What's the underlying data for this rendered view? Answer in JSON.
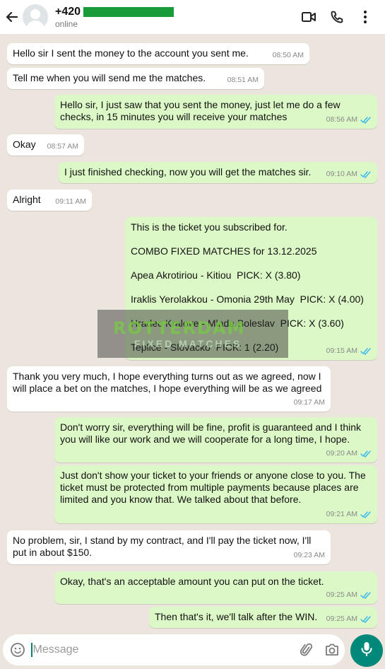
{
  "header": {
    "phone": "+420",
    "status": "online"
  },
  "messages": [
    {
      "side": "in",
      "text": "Hello sir I sent the money to the account you sent me.",
      "time": "08:50 AM"
    },
    {
      "side": "in",
      "text": "Tell me when you will send me the matches.",
      "time": "08:51 AM"
    },
    {
      "side": "out",
      "text": "Hello sir, I just saw that you sent the money, just let me do a few checks, in 15 minutes you will receive your matches",
      "time": "08:56 AM"
    },
    {
      "side": "in",
      "text": "Okay",
      "time": "08:57 AM"
    },
    {
      "side": "out",
      "text": "I just finished checking, now you will get the matches sir.",
      "time": "09:10 AM"
    },
    {
      "side": "in",
      "text": "Alright",
      "time": "09:11 AM"
    },
    {
      "side": "out",
      "text": "This is the ticket you subscribed for.\n\nCOMBO FIXED MATCHES for 13.12.2025\n\nApea Akrotiriou - Kitiou  PICK: X (3.80)\n\nIraklis Yerolakkou - Omonia 29th May  PICK: X (4.00)\n\nHradec Kralove - Mlada Boleslav  PICK: X (3.60)\n\nTeplice - Slovacko  PICK: 1 (2.20)",
      "time": "09:15 AM"
    },
    {
      "side": "in",
      "text": "Thank you very much, I hope everything turns out as we agreed, now I will place a bet on the matches, I hope everything will be as we agreed",
      "time": "09:17 AM"
    },
    {
      "side": "out",
      "text": "Don't worry sir, everything will be fine, profit is guaranteed and I think you will like our work and we will cooperate for a long time, I hope.",
      "time": "09:20 AM"
    },
    {
      "side": "out",
      "text": "Just don't show your ticket to your friends or anyone close to you. The ticket must be protected from multiple payments because places are limited and you know that. We talked about that before.",
      "time": "09:21 AM"
    },
    {
      "side": "in",
      "text": "No problem, sir, I stand by my contract, and I'll pay the ticket now, I'll put in about $150.",
      "time": "09:23 AM"
    },
    {
      "side": "out",
      "text": "Okay, that's an acceptable amount you can put on the ticket.",
      "time": "09:25 AM"
    },
    {
      "side": "out",
      "text": "Then that's it, we'll talk after the WIN.",
      "time": "09:25 AM"
    }
  ],
  "watermark": {
    "line1": "ROTTERDAM",
    "line2": "FIXED MATCHES"
  },
  "input": {
    "placeholder": "Message"
  },
  "colors": {
    "incoming": "#FFFFFF",
    "outgoing": "#DCF8C6",
    "background": "#ECE5DD",
    "read_tick": "#34B7F1",
    "mic_button": "#00897B"
  }
}
